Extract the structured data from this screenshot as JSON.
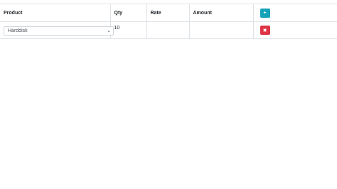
{
  "table": {
    "headers": {
      "product": "Product",
      "qty": "Qty",
      "rate": "Rate",
      "amount": "Amount"
    },
    "add_button_icon": "plus-icon",
    "add_button_glyph": "+",
    "rows": [
      {
        "product": "Harddisk",
        "qty": "10",
        "rate": "",
        "amount": "",
        "remove_button_icon": "close-icon",
        "remove_button_glyph": "✖"
      }
    ]
  },
  "colors": {
    "add_button": "#17a2b8",
    "remove_button": "#dc3545",
    "border": "#dee2e6"
  }
}
